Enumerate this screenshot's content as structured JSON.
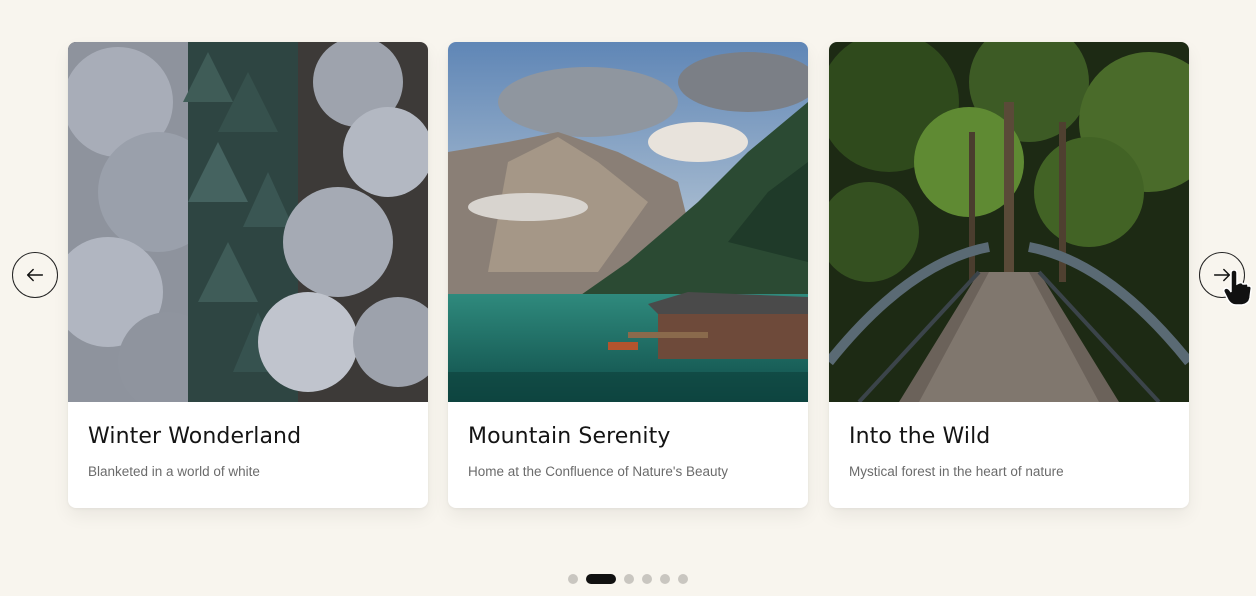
{
  "carousel": {
    "prev_icon": "arrow-left-icon",
    "next_icon": "arrow-right-icon",
    "cards": [
      {
        "title": "Winter Wonderland",
        "subtitle": "Blanketed in a world of white",
        "image_icon": "snowy-forest-photo"
      },
      {
        "title": "Mountain Serenity",
        "subtitle": "Home at the Confluence of Nature's Beauty",
        "image_icon": "mountain-lake-photo"
      },
      {
        "title": "Into the Wild",
        "subtitle": "Mystical forest in the heart of nature",
        "image_icon": "forest-bridge-photo"
      }
    ],
    "pagination": {
      "count": 6,
      "active_index": 1
    }
  },
  "colors": {
    "background": "#f8f5ee",
    "dot_active": "#111111",
    "dot_inactive": "#c9c6c0"
  }
}
